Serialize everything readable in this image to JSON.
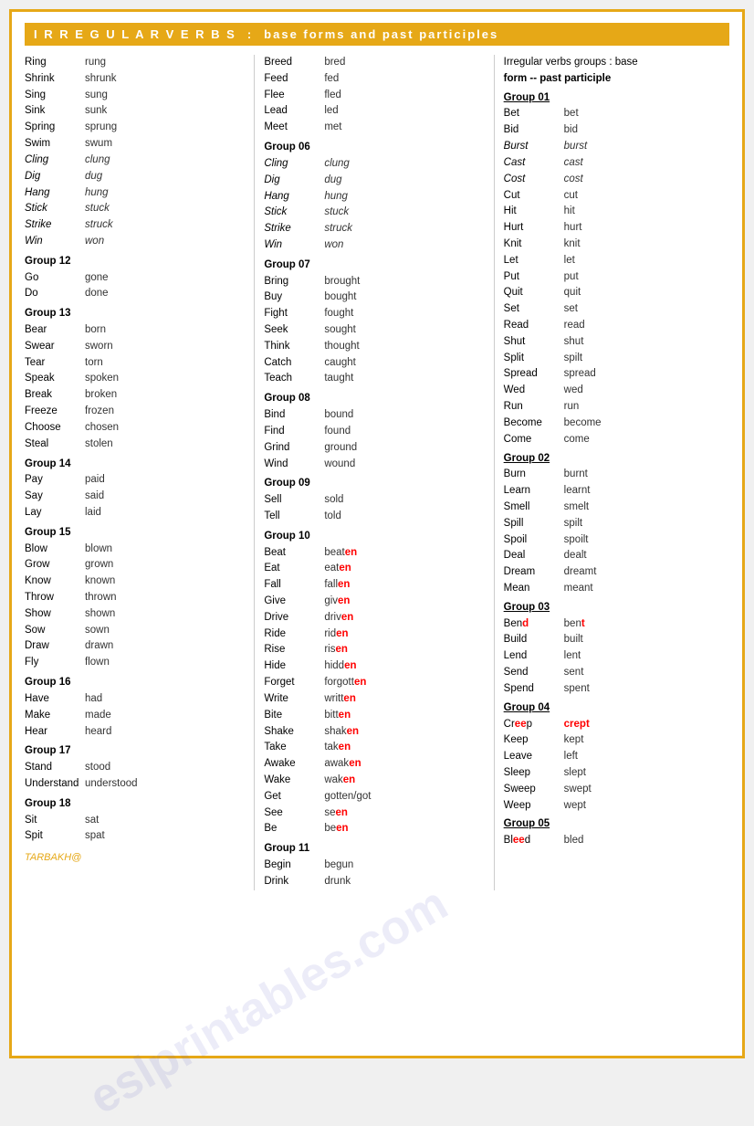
{
  "header": {
    "title": "I R R E G U L A R   V E R B S",
    "colon": ":",
    "subtitle": "base forms  and past participles"
  },
  "col1": {
    "intro": [
      {
        "base": "Ring",
        "past": "rung"
      },
      {
        "base": "Shrink",
        "past": "shrunk"
      },
      {
        "base": "Sing",
        "past": "sung"
      },
      {
        "base": "Sink",
        "past": "sunk"
      },
      {
        "base": "Spring",
        "past": "sprung"
      },
      {
        "base": "Swim",
        "past": "swum"
      }
    ],
    "intro_italic": [
      {
        "base": "Cling",
        "past": "clung",
        "italic": true
      },
      {
        "base": "Dig",
        "past": "dug",
        "italic": true
      },
      {
        "base": "Hang",
        "past": "hung",
        "italic": true
      },
      {
        "base": "Stick",
        "past": "stuck",
        "italic": true
      },
      {
        "base": "Strike",
        "past": "struck",
        "italic": true
      },
      {
        "base": "Win",
        "past": "won",
        "italic": true
      }
    ],
    "groups": [
      {
        "name": "Group 12",
        "verbs": [
          {
            "base": "Go",
            "past": "gone"
          },
          {
            "base": "Do",
            "past": "done"
          }
        ]
      },
      {
        "name": "Group 13",
        "verbs": [
          {
            "base": "Bear",
            "past": "born"
          },
          {
            "base": "Swear",
            "past": "sworn"
          },
          {
            "base": "Tear",
            "past": "torn"
          },
          {
            "base": "Speak",
            "past": "spoken"
          },
          {
            "base": "Break",
            "past": "broken"
          },
          {
            "base": "Freeze",
            "past": "frozen"
          },
          {
            "base": "Choose",
            "past": "chosen"
          },
          {
            "base": "Steal",
            "past": "stolen"
          }
        ]
      },
      {
        "name": "Group 14",
        "verbs": [
          {
            "base": "Pay",
            "past": "paid"
          },
          {
            "base": "Say",
            "past": "said"
          },
          {
            "base": "Lay",
            "past": "laid"
          }
        ]
      },
      {
        "name": "Group 15",
        "verbs": [
          {
            "base": "Blow",
            "past": "blown"
          },
          {
            "base": "Grow",
            "past": "grown"
          },
          {
            "base": "Know",
            "past": "known"
          },
          {
            "base": "Throw",
            "past": "thrown"
          },
          {
            "base": "Show",
            "past": "shown"
          },
          {
            "base": "Sow",
            "past": "sown"
          },
          {
            "base": "Draw",
            "past": "drawn"
          },
          {
            "base": "Fly",
            "past": "flown"
          }
        ]
      },
      {
        "name": "Group 16",
        "verbs": [
          {
            "base": "Have",
            "past": "had"
          },
          {
            "base": "Make",
            "past": "made"
          },
          {
            "base": "Hear",
            "past": "heard"
          }
        ]
      },
      {
        "name": "Group 17",
        "verbs": [
          {
            "base": "Stand",
            "past": "stood"
          },
          {
            "base": "Understand",
            "past": "understood"
          }
        ]
      },
      {
        "name": "Group 18",
        "verbs": [
          {
            "base": "Sit",
            "past": "sat"
          },
          {
            "base": "Spit",
            "past": "spat"
          }
        ]
      }
    ],
    "tarbakh": "TARBAKH@"
  },
  "col2": {
    "intro": [
      {
        "base": "Breed",
        "past": "bred"
      },
      {
        "base": "Feed",
        "past": "fed"
      },
      {
        "base": "Flee",
        "past": "fled"
      },
      {
        "base": "Lead",
        "past": "led"
      },
      {
        "base": "Meet",
        "past": "met"
      }
    ],
    "groups": [
      {
        "name": "Group 06",
        "italic": true,
        "verbs": [
          {
            "base": "Cling",
            "past": "clung"
          },
          {
            "base": "Dig",
            "past": "dug"
          },
          {
            "base": "Hang",
            "past": "hung"
          },
          {
            "base": "Stick",
            "past": "stuck"
          },
          {
            "base": "Strike",
            "past": "struck"
          },
          {
            "base": "Win",
            "past": "won"
          }
        ]
      },
      {
        "name": "Group 07",
        "verbs": [
          {
            "base": "Bring",
            "past": "brought"
          },
          {
            "base": "Buy",
            "past": "bought"
          },
          {
            "base": "Fight",
            "past": "fought"
          },
          {
            "base": "Seek",
            "past": "sought"
          },
          {
            "base": "Think",
            "past": "thought"
          },
          {
            "base": "Catch",
            "past": "caught"
          },
          {
            "base": "Teach",
            "past": "taught"
          }
        ]
      },
      {
        "name": "Group 08",
        "verbs": [
          {
            "base": "Bind",
            "past": "bound"
          },
          {
            "base": "Find",
            "past": "found"
          },
          {
            "base": "Grind",
            "past": "ground"
          },
          {
            "base": "Wind",
            "past": "wound"
          }
        ]
      },
      {
        "name": "Group 09",
        "verbs": [
          {
            "base": "Sell",
            "past": "sold"
          },
          {
            "base": "Tell",
            "past": "told"
          }
        ]
      },
      {
        "name": "Group 10",
        "verbs": [
          {
            "base": "Beat",
            "past": "beaten",
            "past_special": "beat<en>"
          },
          {
            "base": "Eat",
            "past": "eaten",
            "past_special": "eat<en>"
          },
          {
            "base": "Fall",
            "past": "fallen",
            "past_special": "fall<en>"
          },
          {
            "base": "Give",
            "past": "given",
            "past_special": "giv<en>"
          },
          {
            "base": "Drive",
            "past": "driven",
            "past_special": "driv<en>"
          },
          {
            "base": "Ride",
            "past": "ridden",
            "past_special": "rid<en>"
          },
          {
            "base": "Rise",
            "past": "risen",
            "past_special": "ris<en>"
          },
          {
            "base": "Hide",
            "past": "hidden",
            "past_special": "hidd<en>"
          },
          {
            "base": "Forget",
            "past": "forgotten",
            "past_special": "forgott<en>"
          },
          {
            "base": "Write",
            "past": "written",
            "past_special": "writt<en>"
          },
          {
            "base": "Bite",
            "past": "bitten",
            "past_special": "bitt<en>"
          },
          {
            "base": "Shake",
            "past": "shaken",
            "past_special": "shak<en>"
          },
          {
            "base": "Take",
            "past": "taken",
            "past_special": "tak<en>"
          },
          {
            "base": "Awake",
            "past": "awaken",
            "past_special": "awak<en>"
          },
          {
            "base": "Wake",
            "past": "waken",
            "past_special": "wak<en>"
          },
          {
            "base": "Get",
            "past": "gotten/got"
          },
          {
            "base": "See",
            "past": "seen",
            "past_special": "se<en>"
          },
          {
            "base": "Be",
            "past": "been",
            "past_special": "be<en>"
          }
        ]
      },
      {
        "name": "Group 11",
        "verbs": [
          {
            "base": "Begin",
            "past": "begun"
          },
          {
            "base": "Drink",
            "past": "drunk"
          }
        ]
      }
    ]
  },
  "col3": {
    "header_line1": "Irregular verbs groups : base",
    "header_line2": "form --  past participle",
    "groups": [
      {
        "name": "Group 01",
        "verbs": [
          {
            "base": "Bet",
            "past": "bet"
          },
          {
            "base": "Bid",
            "past": "bid"
          },
          {
            "base": "Burst",
            "past": "burst",
            "italic": true
          },
          {
            "base": "Cast",
            "past": "cast",
            "italic": true
          },
          {
            "base": "Cost",
            "past": "cost",
            "italic": true
          },
          {
            "base": "Cut",
            "past": "cut"
          },
          {
            "base": "Hit",
            "past": "hit"
          },
          {
            "base": "Hurt",
            "past": "hurt"
          },
          {
            "base": "Knit",
            "past": "knit"
          },
          {
            "base": "Let",
            "past": "let"
          },
          {
            "base": "Put",
            "past": "put"
          },
          {
            "base": "Quit",
            "past": "quit"
          },
          {
            "base": "Set",
            "past": "set"
          },
          {
            "base": "Read",
            "past": "read"
          },
          {
            "base": "Shut",
            "past": "shut"
          },
          {
            "base": "Split",
            "past": "spilt"
          },
          {
            "base": "Spread",
            "past": "spread"
          },
          {
            "base": "Wed",
            "past": "wed"
          },
          {
            "base": "Run",
            "past": "run"
          },
          {
            "base": "Become",
            "past": "become"
          },
          {
            "base": "Come",
            "past": "come"
          }
        ]
      },
      {
        "name": "Group 02",
        "verbs": [
          {
            "base": "Burn",
            "past": "burnt"
          },
          {
            "base": "Learn",
            "past": "learnt"
          },
          {
            "base": "Smell",
            "past": "smelt"
          },
          {
            "base": "Spill",
            "past": "spilt"
          },
          {
            "base": "Spoil",
            "past": "spoilt"
          },
          {
            "base": "Deal",
            "past": "dealt"
          },
          {
            "base": "Dream",
            "past": "dreamt"
          },
          {
            "base": "Mean",
            "past": "meant"
          }
        ]
      },
      {
        "name": "Group 03",
        "verbs": [
          {
            "base": "Bend",
            "past": "bent",
            "base_special": true
          },
          {
            "base": "Build",
            "past": "built"
          },
          {
            "base": "Lend",
            "past": "lent"
          },
          {
            "base": "Send",
            "past": "sent"
          },
          {
            "base": "Spend",
            "past": "spent"
          }
        ]
      },
      {
        "name": "Group 04",
        "verbs": [
          {
            "base": "Creep",
            "past": "crept",
            "base_special2": true
          },
          {
            "base": "Keep",
            "past": "kept"
          },
          {
            "base": "Leave",
            "past": "left"
          },
          {
            "base": "Sleep",
            "past": "slept"
          },
          {
            "base": "Sweep",
            "past": "swept"
          },
          {
            "base": "Weep",
            "past": "wept"
          }
        ]
      },
      {
        "name": "Group 05",
        "verbs": [
          {
            "base": "Bleed",
            "past": "bled",
            "base_special3": true
          }
        ]
      }
    ]
  }
}
